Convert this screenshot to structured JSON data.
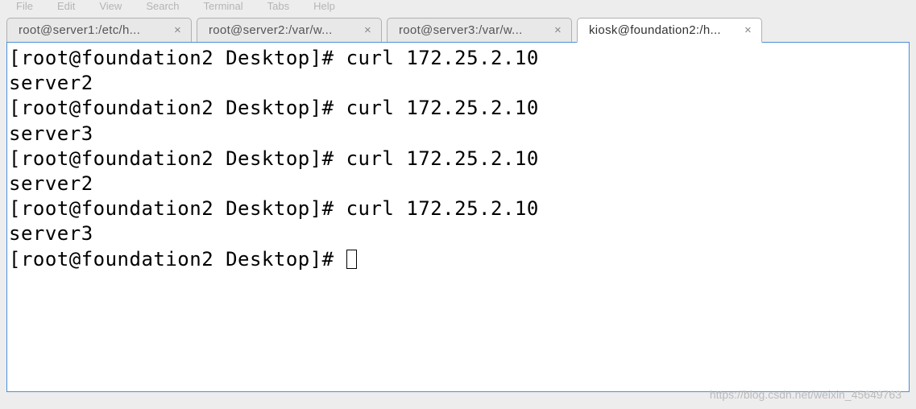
{
  "menu": {
    "file": "File",
    "edit": "Edit",
    "view": "View",
    "search": "Search",
    "terminal": "Terminal",
    "tabs": "Tabs",
    "help": "Help"
  },
  "tabs": [
    {
      "label": "root@server1:/etc/h...",
      "active": false
    },
    {
      "label": "root@server2:/var/w...",
      "active": false
    },
    {
      "label": "root@server3:/var/w...",
      "active": false
    },
    {
      "label": "kiosk@foundation2:/h...",
      "active": true
    }
  ],
  "terminal": {
    "lines": [
      "[root@foundation2 Desktop]# curl 172.25.2.10",
      "server2",
      "[root@foundation2 Desktop]# curl 172.25.2.10",
      "server3",
      "[root@foundation2 Desktop]# curl 172.25.2.10",
      "server2",
      "[root@foundation2 Desktop]# curl 172.25.2.10",
      "server3",
      "[root@foundation2 Desktop]# "
    ]
  },
  "watermark": "https://blog.csdn.net/weixin_45649763"
}
